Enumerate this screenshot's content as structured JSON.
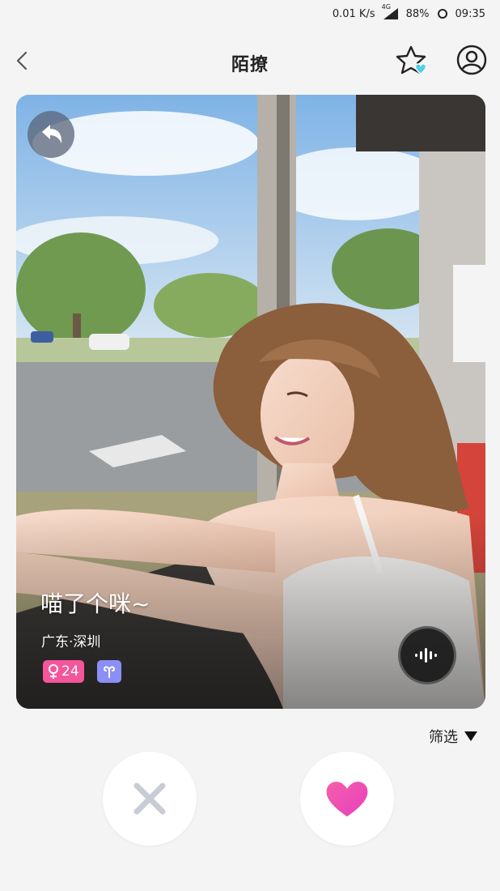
{
  "status_bar": {
    "speed": "0.01 K/s",
    "network": "4G",
    "battery": "88%",
    "time": "09:35"
  },
  "header": {
    "title": "陌撩",
    "back_icon": "chevron-left-icon",
    "favorite_icon": "star-heart-icon",
    "profile_icon": "user-circle-icon"
  },
  "card": {
    "name": "喵了个咪~",
    "location": "广东·深圳",
    "age": "24",
    "gender_icon": "female-icon",
    "zodiac_icon": "aries-icon",
    "undo_icon": "undo-arrow-icon",
    "voice_icon": "voice-wave-icon"
  },
  "filter": {
    "label": "筛选"
  },
  "actions": {
    "dislike_icon": "close-icon",
    "like_icon": "heart-icon"
  },
  "colors": {
    "background": "#f4f4f4",
    "like": "#f050b4",
    "dislike": "#c8ccd4",
    "age_badge": "#f5559a",
    "zodiac_badge": "#8c8ff5",
    "favorite_accent": "#4fd0e8"
  }
}
